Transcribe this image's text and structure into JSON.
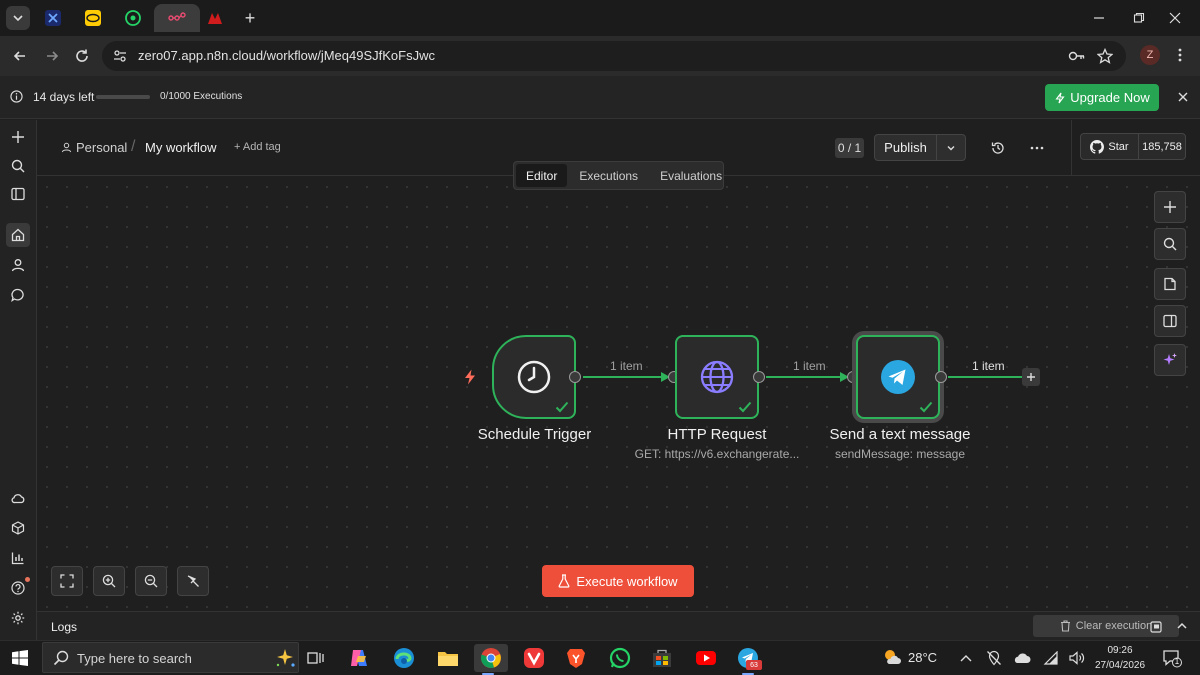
{
  "browser": {
    "url": "zero07.app.n8n.cloud/workflow/jMeq49SJfKoFsJwc",
    "profile_initial": "Z",
    "tabs": [
      {
        "icon": "cross-favicon-icon"
      },
      {
        "icon": "mtn-favicon-icon"
      },
      {
        "icon": "whatsapp-favicon-icon"
      },
      {
        "icon": "n8n-favicon-icon",
        "active": true
      },
      {
        "icon": "red-logo-favicon-icon"
      }
    ]
  },
  "banner": {
    "days_left": "14 days left",
    "executions": "0/1000 Executions",
    "usage_fraction": 0.0,
    "upgrade_label": "Upgrade Now"
  },
  "header": {
    "project": "Personal",
    "workflow_name": "My workflow",
    "add_tag": "+ Add tag",
    "counter": "0 / 1",
    "publish_label": "Publish",
    "github_star_label": "Star",
    "github_star_count": "185,758"
  },
  "view_tabs": {
    "editor": "Editor",
    "executions": "Executions",
    "evaluations": "Evaluations",
    "active": "Editor"
  },
  "nodes": [
    {
      "id": "schedule-trigger",
      "label": "Schedule Trigger",
      "subtitle": "",
      "icon": "clock-icon",
      "status": "success"
    },
    {
      "id": "http-request",
      "label": "HTTP Request",
      "subtitle": "GET: https://v6.exchangerate...",
      "icon": "globe-icon",
      "status": "success"
    },
    {
      "id": "send-text-message",
      "label": "Send a text message",
      "subtitle": "sendMessage: message",
      "icon": "telegram-icon",
      "status": "success"
    }
  ],
  "connections": [
    {
      "from": "schedule-trigger",
      "to": "http-request",
      "label": "1 item"
    },
    {
      "from": "http-request",
      "to": "send-text-message",
      "label": "1 item"
    },
    {
      "from": "send-text-message",
      "to": "",
      "label": "1 item"
    }
  ],
  "execute_label": "Execute workflow",
  "logs": {
    "title": "Logs",
    "clear_label": "Clear execution"
  },
  "colors": {
    "success_green": "#2eb35a",
    "upgrade_green": "#27a552",
    "execute_red": "#ee4f3a",
    "trigger_bolt": "#ff6d5a",
    "canvas_bg": "#1f1f1f"
  },
  "taskbar": {
    "search_placeholder": "Type here to search",
    "temperature": "28°C",
    "time": "09:26",
    "date": "27/04/2026",
    "telegram_badge": "63",
    "notification_count": "1"
  }
}
